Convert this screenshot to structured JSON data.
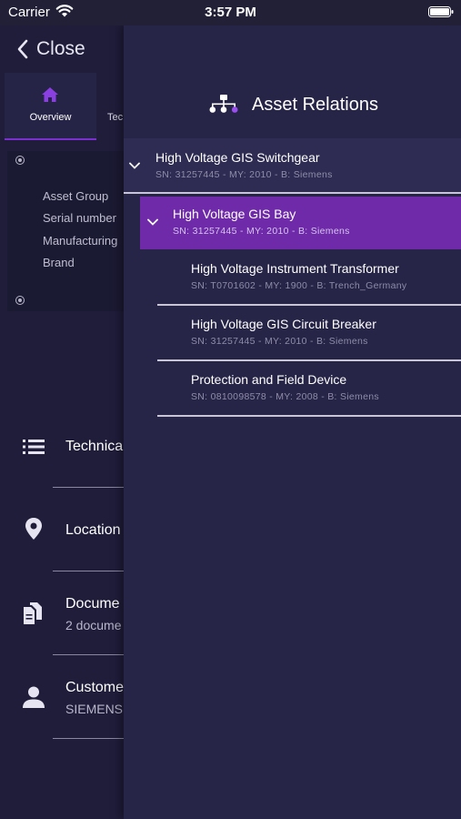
{
  "status_bar": {
    "carrier": "Carrier",
    "time": "3:57 PM"
  },
  "left_panel": {
    "close_label": "Close",
    "tabs": [
      {
        "label": "Overview",
        "icon": "home-icon",
        "active": true
      },
      {
        "label": "Tec",
        "active": false
      }
    ],
    "info_rows": [
      "Asset Group",
      "Serial number",
      "Manufacturing",
      "Brand"
    ],
    "list_items": [
      {
        "icon": "list-icon",
        "title": "Technica",
        "sub": ""
      },
      {
        "icon": "location-pin-icon",
        "title": "Location",
        "sub": ""
      },
      {
        "icon": "documents-icon",
        "title": "Docume",
        "sub": "2 docume"
      },
      {
        "icon": "person-icon",
        "title": "Custome",
        "sub": "SIEMENS"
      }
    ]
  },
  "drawer": {
    "title": "Asset Relations",
    "icon": "hierarchy-icon",
    "nodes": [
      {
        "title": "High Voltage GIS Switchgear",
        "meta": "SN: 31257445 - MY: 2010 - B: Siemens",
        "expanded": true
      },
      {
        "title": "High Voltage GIS Bay",
        "meta": "SN: 31257445 - MY: 2010 - B: Siemens",
        "expanded": true,
        "selected": true
      },
      {
        "title": "High Voltage Instrument Transformer",
        "meta": "SN: T0701602 - MY: 1900 - B: Trench_Germany"
      },
      {
        "title": "High Voltage GIS Circuit Breaker",
        "meta": "SN: 31257445 - MY: 2010 - B: Siemens"
      },
      {
        "title": "Protection and Field Device",
        "meta": "SN: 0810098578 - MY: 2008 - B: Siemens"
      }
    ]
  },
  "colors": {
    "background": "#1f1d3a",
    "drawer": "#262447",
    "selected": "#6e2aa8",
    "accent": "#7b2fd0"
  }
}
